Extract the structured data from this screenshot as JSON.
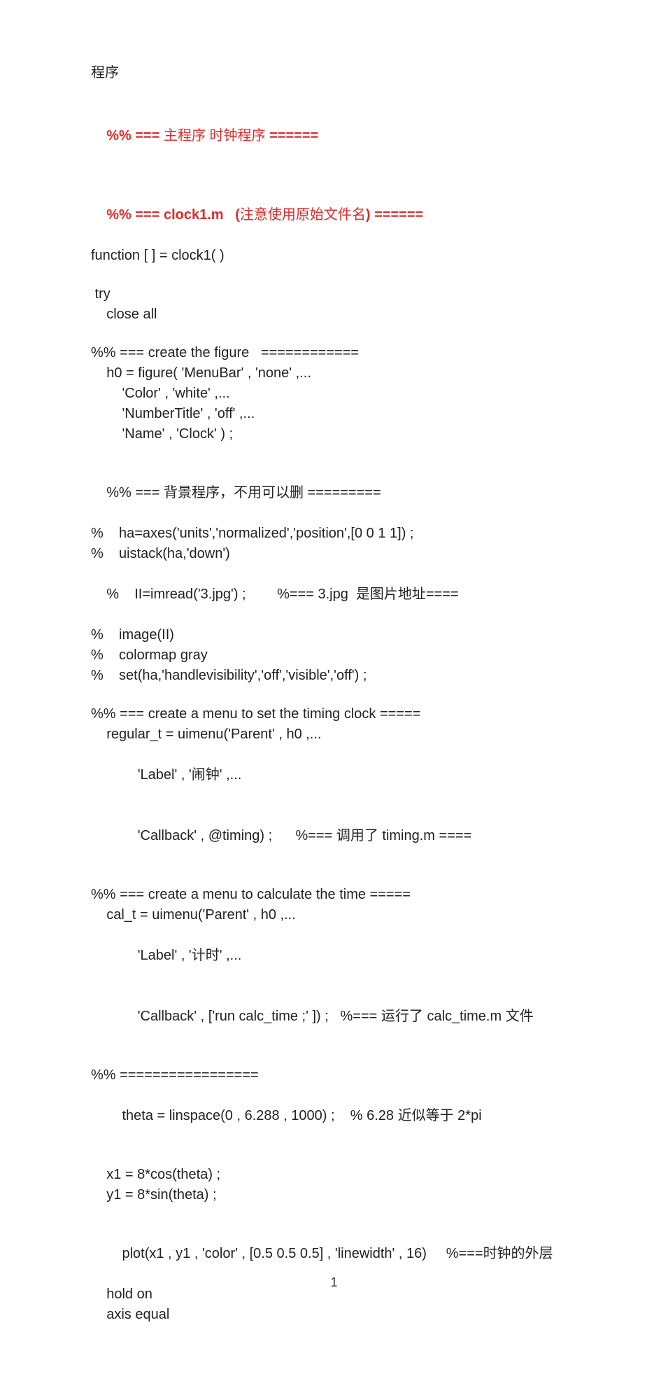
{
  "title": "程序",
  "h1_a": "%% ===",
  "h1_b": "主程序 时钟程序",
  "h1_c": "======",
  "h2_a": "%% === clock1.m   (",
  "h2_b": "注意使用原始文件名",
  "h2_c": ") ======",
  "l01": "function [ ] = clock1( )",
  "l02": " try",
  "l03": "    close all",
  "l04": "%% === create the figure   ============",
  "l05": "    h0 = figure( 'MenuBar' , 'none' ,...",
  "l06": "        'Color' , 'white' ,...",
  "l07": "        'NumberTitle' , 'off' ,...",
  "l08": "        'Name' , 'Clock' ) ;",
  "l09_a": "%% ===",
  "l09_b": "背景程序，不用可以删",
  "l09_c": "=========",
  "l10": "%    ha=axes('units','normalized','position',[0 0 1 1]) ;",
  "l11": "%    uistack(ha,'down')",
  "l12_a": "%    II=imread('3.jpg') ;        %=== 3.jpg",
  "l12_b": "是图片地址",
  "l12_c": "====",
  "l13": "%    image(II)",
  "l14": "%    colormap gray",
  "l15": "%    set(ha,'handlevisibility','off','visible','off') ;",
  "l16": "%% === create a menu to set the timing clock =====",
  "l17": "    regular_t = uimenu('Parent' , h0 ,...",
  "l18_a": "        'Label' , '",
  "l18_b": "闹钟",
  "l18_c": "' ,...",
  "l19_a": "        'Callback' , @timing) ;      %===",
  "l19_b": "调用了",
  "l19_c": " timing.m ====",
  "l20": "%% === create a menu to calculate the time =====",
  "l21": "    cal_t = uimenu('Parent' , h0 ,...",
  "l22_a": "        'Label' , '",
  "l22_b": "计时",
  "l22_c": "' ,...",
  "l23_a": "        'Callback' , ['run calc_time ;' ]) ;   %===",
  "l23_b": "运行了",
  "l23_c": " calc_time.m",
  "l23_d": "文件",
  "l24": "%% =================",
  "l25_a": "    theta = linspace(0 , 6.288 , 1000) ;    % 6.28",
  "l25_b": "近似等于",
  "l25_c": " 2*pi",
  "l26": "    x1 = 8*cos(theta) ;",
  "l27": "    y1 = 8*sin(theta) ;",
  "l28_a": "    plot(x1 , y1 , 'color' , [0.5 0.5 0.5] , 'linewidth' , 16)     %===",
  "l28_b": "时钟的外层",
  "l29": "    hold on",
  "l30": "    axis equal",
  "pagenum": "1"
}
